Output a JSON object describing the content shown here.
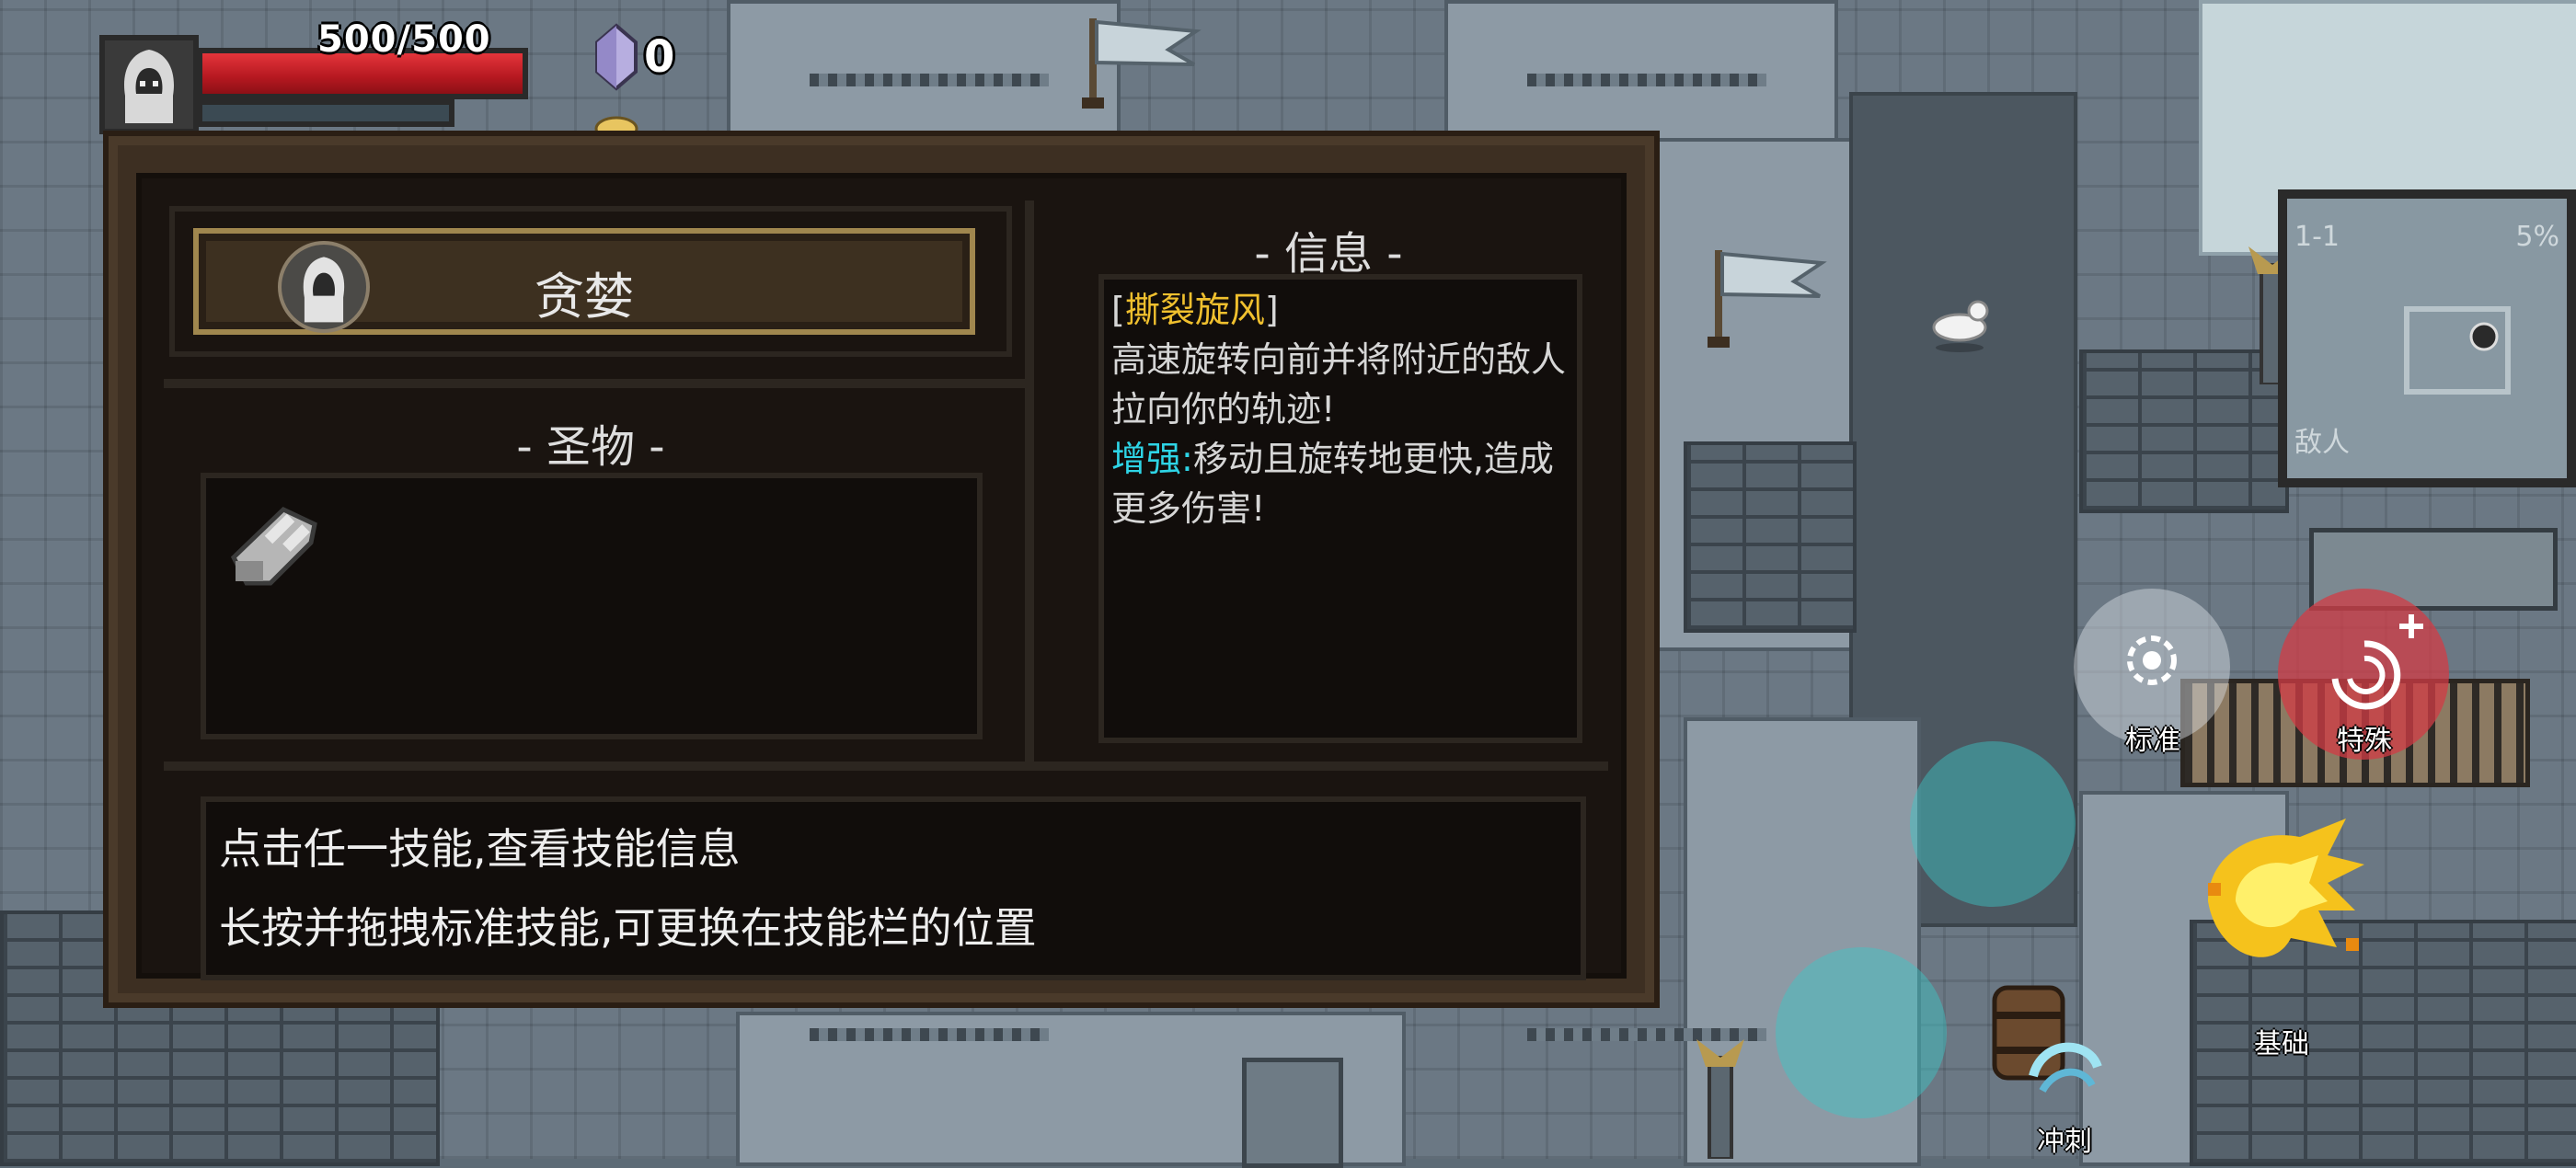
{
  "hud": {
    "hp_text": "500/500",
    "hp_fraction": 1.0,
    "gem_count": "0",
    "hp_color": "#c9232b"
  },
  "minimap": {
    "level": "1-1",
    "percent": "5%",
    "enemies_label": "敌人"
  },
  "panel": {
    "character_name": "贪婪",
    "relic_heading": "- 圣物 -",
    "info_heading": "- 信息 -",
    "skill_name": "撕裂旋风",
    "skill_name_color": "#f0c02e",
    "skill_desc": "高速旋转向前并将附近的敌人拉向你的轨迹!",
    "enhance_label": "增强:",
    "enhance_color": "#2ed4e6",
    "enhance_desc": "移动且旋转地更快,造成更多伤害!",
    "hint_line1": "点击任一技能,查看技能信息",
    "hint_line2": "长按并拖拽标准技能,可更换在技能栏的位置"
  },
  "skills": {
    "standard_label": "标准",
    "special_label": "特殊",
    "basic_label": "基础",
    "dash_label": "冲刺"
  }
}
